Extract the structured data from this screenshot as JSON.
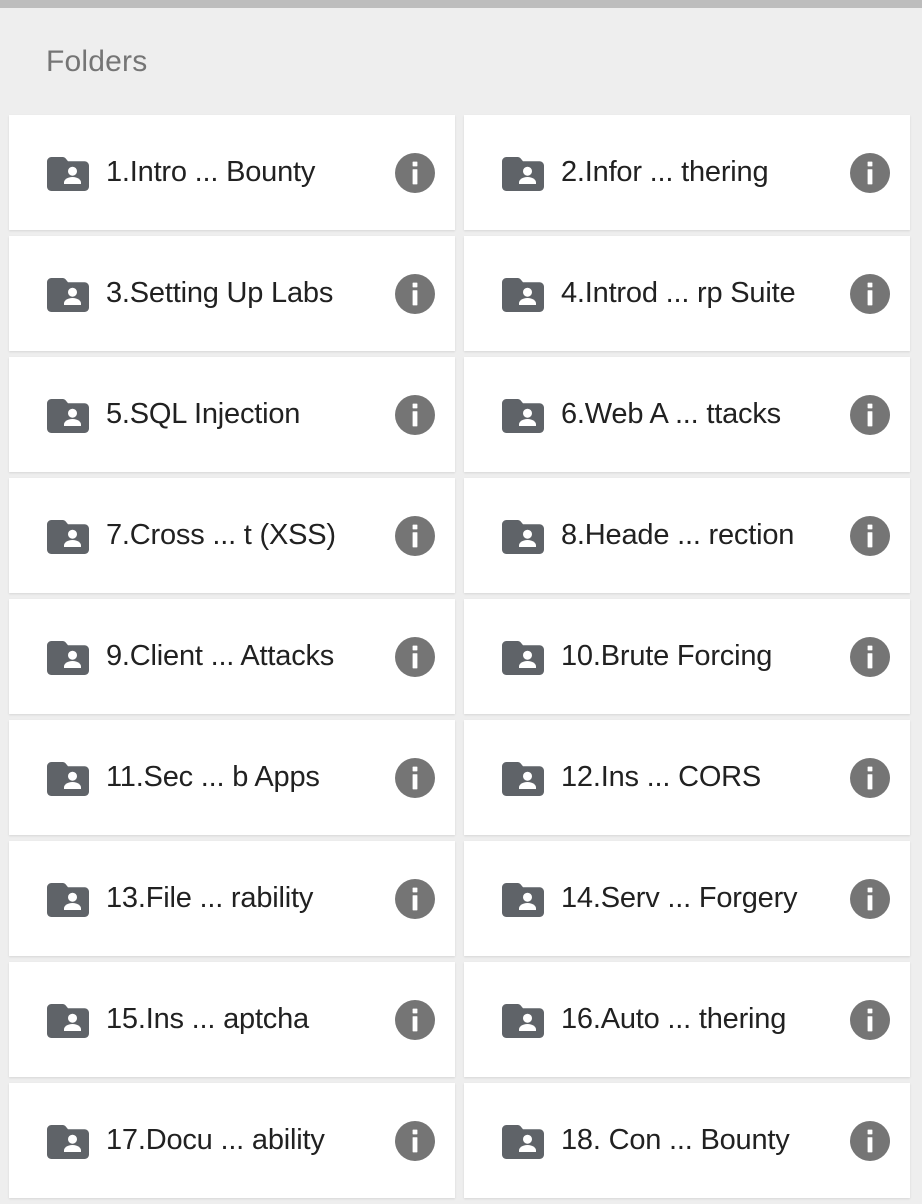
{
  "header": {
    "section_title": "Folders"
  },
  "colors": {
    "page_background": "#eeeeee",
    "status_strip": "#bdbdbd",
    "card_background": "#ffffff",
    "folder_icon": "#5f6368",
    "info_icon": "#757575",
    "label_text": "#212121",
    "section_title_text": "#757575"
  },
  "icons": {
    "folder": "shared-folder-icon",
    "info": "info-circle-icon"
  },
  "folders": [
    {
      "label": "1.Intro ... Bounty"
    },
    {
      "label": "2.Infor ... thering"
    },
    {
      "label": "3.Setting Up Labs"
    },
    {
      "label": "4.Introd ... rp Suite"
    },
    {
      "label": "5.SQL Injection"
    },
    {
      "label": "6.Web A ... ttacks"
    },
    {
      "label": "7.Cross ... t (XSS)"
    },
    {
      "label": "8.Heade ... rection"
    },
    {
      "label": "9.Client ... Attacks"
    },
    {
      "label": "10.Brute Forcing"
    },
    {
      "label": "11.Sec ... b Apps"
    },
    {
      "label": "12.Ins ... CORS"
    },
    {
      "label": "13.File ... rability"
    },
    {
      "label": "14.Serv ... Forgery"
    },
    {
      "label": "15.Ins ... aptcha"
    },
    {
      "label": "16.Auto ... thering"
    },
    {
      "label": "17.Docu ... ability"
    },
    {
      "label": "18. Con ... Bounty"
    }
  ]
}
